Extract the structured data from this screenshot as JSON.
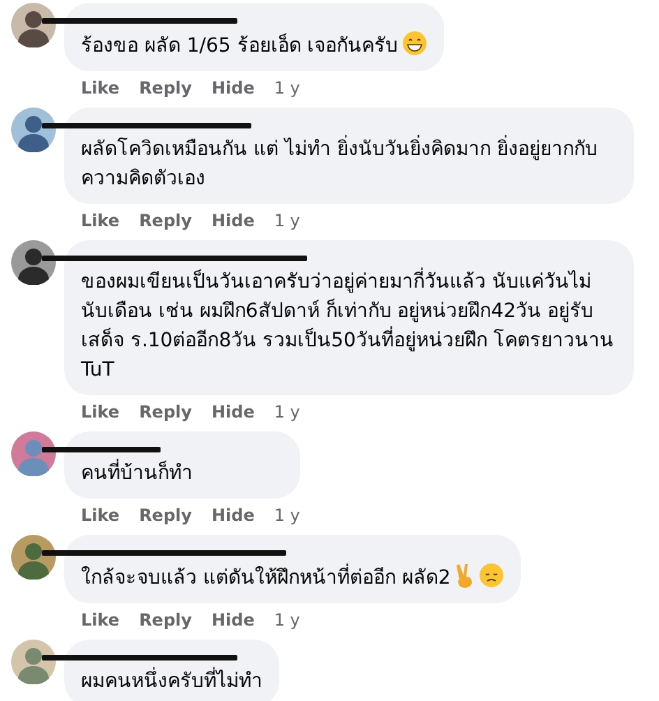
{
  "comments": [
    {
      "text": "ร้องขอ ผลัด 1/65 ร้อยเอ็ด เจอกันครับ",
      "emojis": [
        {
          "kind": "grin"
        }
      ],
      "actions": [
        "Like",
        "Reply",
        "Hide"
      ],
      "time": "1 y"
    },
    {
      "text": "ผลัดโควิดเหมือนกัน แต่ ไม่ทำ ยิ่งนับวันยิ่งคิดมาก ยิ่งอยู่ยากกับความคิดตัวเอง",
      "actions": [
        "Like",
        "Reply",
        "Hide"
      ],
      "time": "1 y"
    },
    {
      "text": "ของผมเขียนเป็นวันเอาครับว่าอยู่ค่ายมากี่วันแล้ว นับแค่วันไม่นับเดือน เช่น ผมฝึก6สัปดาห์ ก็เท่ากับ อยู่หน่วยฝึก42วัน อยู่รับเสด็จ ร.10ต่ออีก8วัน รวมเป็น50วันที่อยู่หน่วยฝึก โคตรยาวนาน TuT",
      "actions": [
        "Like",
        "Reply",
        "Hide"
      ],
      "time": "1 y"
    },
    {
      "text": "คนที่บ้านก็ทำ",
      "actions": [
        "Like",
        "Reply",
        "Hide"
      ],
      "time": "1 y"
    },
    {
      "text": "ใกล้จะจบแล้ว แต่ดันให้ฝึกหน้าที่ต่ออีก ผลัด2",
      "emojis": [
        {
          "kind": "victory"
        },
        {
          "kind": "sad"
        }
      ],
      "actions": [
        "Like",
        "Reply",
        "Hide"
      ],
      "time": "1 y"
    },
    {
      "text": "ผมคนหนึ่งครับที่ไม่ทำ"
    }
  ]
}
